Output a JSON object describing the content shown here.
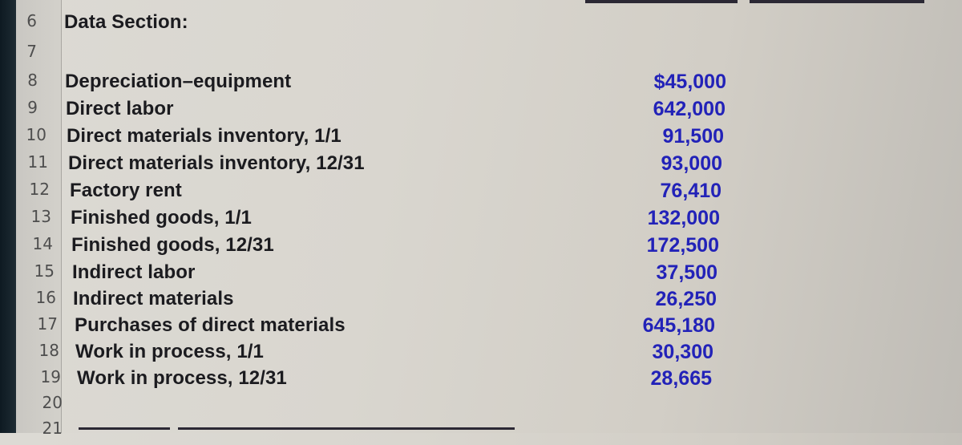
{
  "sheet": {
    "partial_row_top": "5",
    "rows": [
      {
        "num": "6",
        "label": "Data Section:",
        "value": ""
      },
      {
        "num": "7",
        "label": "",
        "value": ""
      },
      {
        "num": "8",
        "label": "Depreciation–equipment",
        "value": "$45,000"
      },
      {
        "num": "9",
        "label": "Direct labor",
        "value": "642,000"
      },
      {
        "num": "10",
        "label": "Direct materials inventory, 1/1",
        "value": "91,500"
      },
      {
        "num": "11",
        "label": "Direct materials inventory, 12/31",
        "value": "93,000"
      },
      {
        "num": "12",
        "label": "Factory rent",
        "value": "76,410"
      },
      {
        "num": "13",
        "label": "Finished goods, 1/1",
        "value": "132,000"
      },
      {
        "num": "14",
        "label": "Finished goods, 12/31",
        "value": "172,500"
      },
      {
        "num": "15",
        "label": "Indirect labor",
        "value": "37,500"
      },
      {
        "num": "16",
        "label": "Indirect materials",
        "value": "26,250"
      },
      {
        "num": "17",
        "label": "Purchases of direct materials",
        "value": "645,180"
      },
      {
        "num": "18",
        "label": "Work in process, 1/1",
        "value": "30,300"
      },
      {
        "num": "19",
        "label": "Work in process, 12/31",
        "value": "28,665"
      },
      {
        "num": "20",
        "label": "",
        "value": ""
      },
      {
        "num": "21",
        "label": "",
        "value": ""
      }
    ]
  },
  "colors": {
    "label_text": "#1b1b1f",
    "value_text": "#2222b8",
    "row_number_text": "#4e4e4e"
  }
}
